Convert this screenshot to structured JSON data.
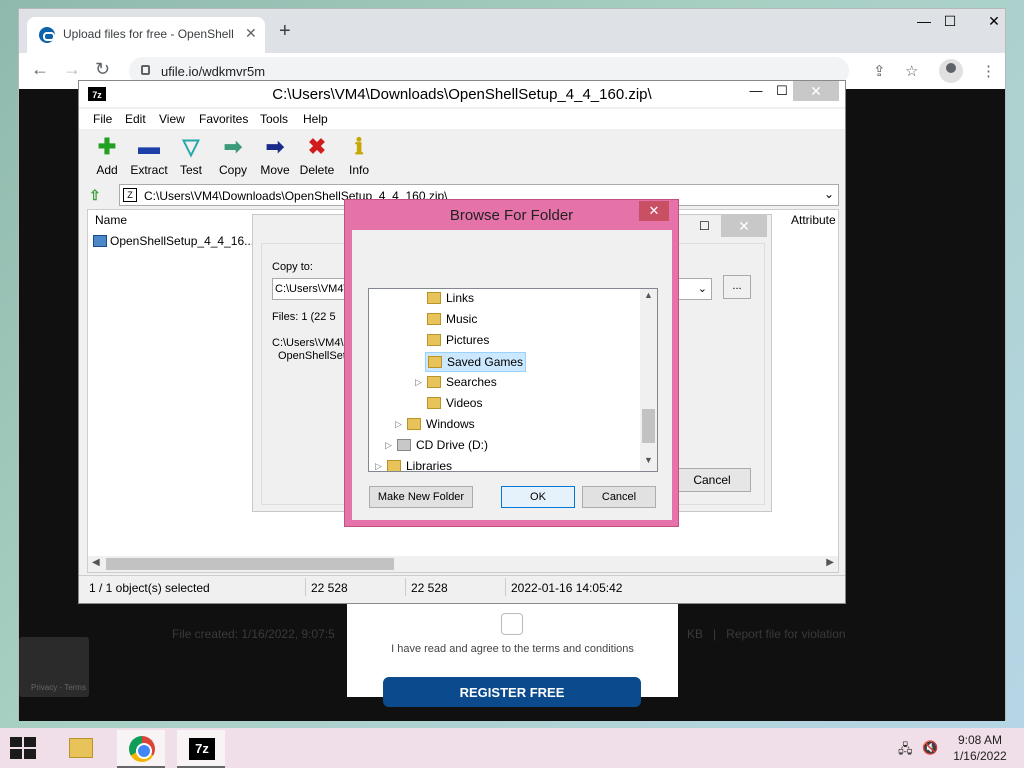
{
  "browser": {
    "tab_title": "Upload files for free - OpenShell",
    "tab_close": "✕",
    "new_tab": "+",
    "url": "ufile.io/wdkmvr5m",
    "window_controls": {
      "minimize": "—",
      "maximize": "☐",
      "close": "✕"
    }
  },
  "webpage": {
    "file_created": "File created: 1/16/2022, 9:07:5",
    "size_frag": "KB",
    "divider": "|",
    "report": "Report file for violation",
    "terms": "I have read and agree to the terms and conditions",
    "register": "REGISTER FREE",
    "recaptcha_label": "Privacy - Terms"
  },
  "sevenzip": {
    "title": "C:\\Users\\VM4\\Downloads\\OpenShellSetup_4_4_160.zip\\",
    "app_icon": "7z",
    "menu": [
      "File",
      "Edit",
      "View",
      "Favorites",
      "Tools",
      "Help"
    ],
    "toolbar": [
      {
        "label": "Add",
        "glyph": "✚",
        "color": "#22a022"
      },
      {
        "label": "Extract",
        "glyph": "▬",
        "color": "#1d3fa8"
      },
      {
        "label": "Test",
        "glyph": "▽",
        "color": "#25a8a8"
      },
      {
        "label": "Copy",
        "glyph": "➡",
        "color": "#3a9a7a"
      },
      {
        "label": "Move",
        "glyph": "➡",
        "color": "#1a2a8a"
      },
      {
        "label": "Delete",
        "glyph": "✖",
        "color": "#d01c1c"
      },
      {
        "label": "Info",
        "glyph": "ℹ",
        "color": "#c8a800"
      }
    ],
    "address": "C:\\Users\\VM4\\Downloads\\OpenShellSetup_4_4_160.zip\\",
    "columns": {
      "name": "Name",
      "attributes": "Attribute"
    },
    "file": "OpenShellSetup_4_4_16...",
    "status": {
      "selected": "1 / 1 object(s) selected",
      "size": "22 528",
      "packed": "22 528",
      "modified": "2022-01-16 14:05:42"
    }
  },
  "copy_dialog": {
    "copy_to_label": "Copy to:",
    "path_value": "C:\\Users\\VM4\\",
    "files_info": "Files: 1    (22 5",
    "dest_line1": "C:\\Users\\VM4\\",
    "dest_line2": "OpenShellSetu",
    "browse_label": "...",
    "cancel_label": "Cancel"
  },
  "browse_dialog": {
    "title": "Browse For Folder",
    "tree": [
      {
        "label": "Links",
        "expander": ""
      },
      {
        "label": "Music",
        "expander": ""
      },
      {
        "label": "Pictures",
        "expander": ""
      },
      {
        "label": "Saved Games",
        "expander": "",
        "selected": true
      },
      {
        "label": "Searches",
        "expander": "▷"
      },
      {
        "label": "Videos",
        "expander": ""
      },
      {
        "label": "Windows",
        "expander": "▷"
      },
      {
        "label": "CD Drive (D:)",
        "expander": "▷"
      },
      {
        "label": "Libraries",
        "expander": "▷"
      }
    ],
    "make_new_folder": "Make New Folder",
    "ok": "OK",
    "cancel": "Cancel"
  },
  "taskbar": {
    "time": "9:08 AM",
    "date": "1/16/2022",
    "items": [
      "file-explorer",
      "google-chrome",
      "7-zip"
    ]
  }
}
